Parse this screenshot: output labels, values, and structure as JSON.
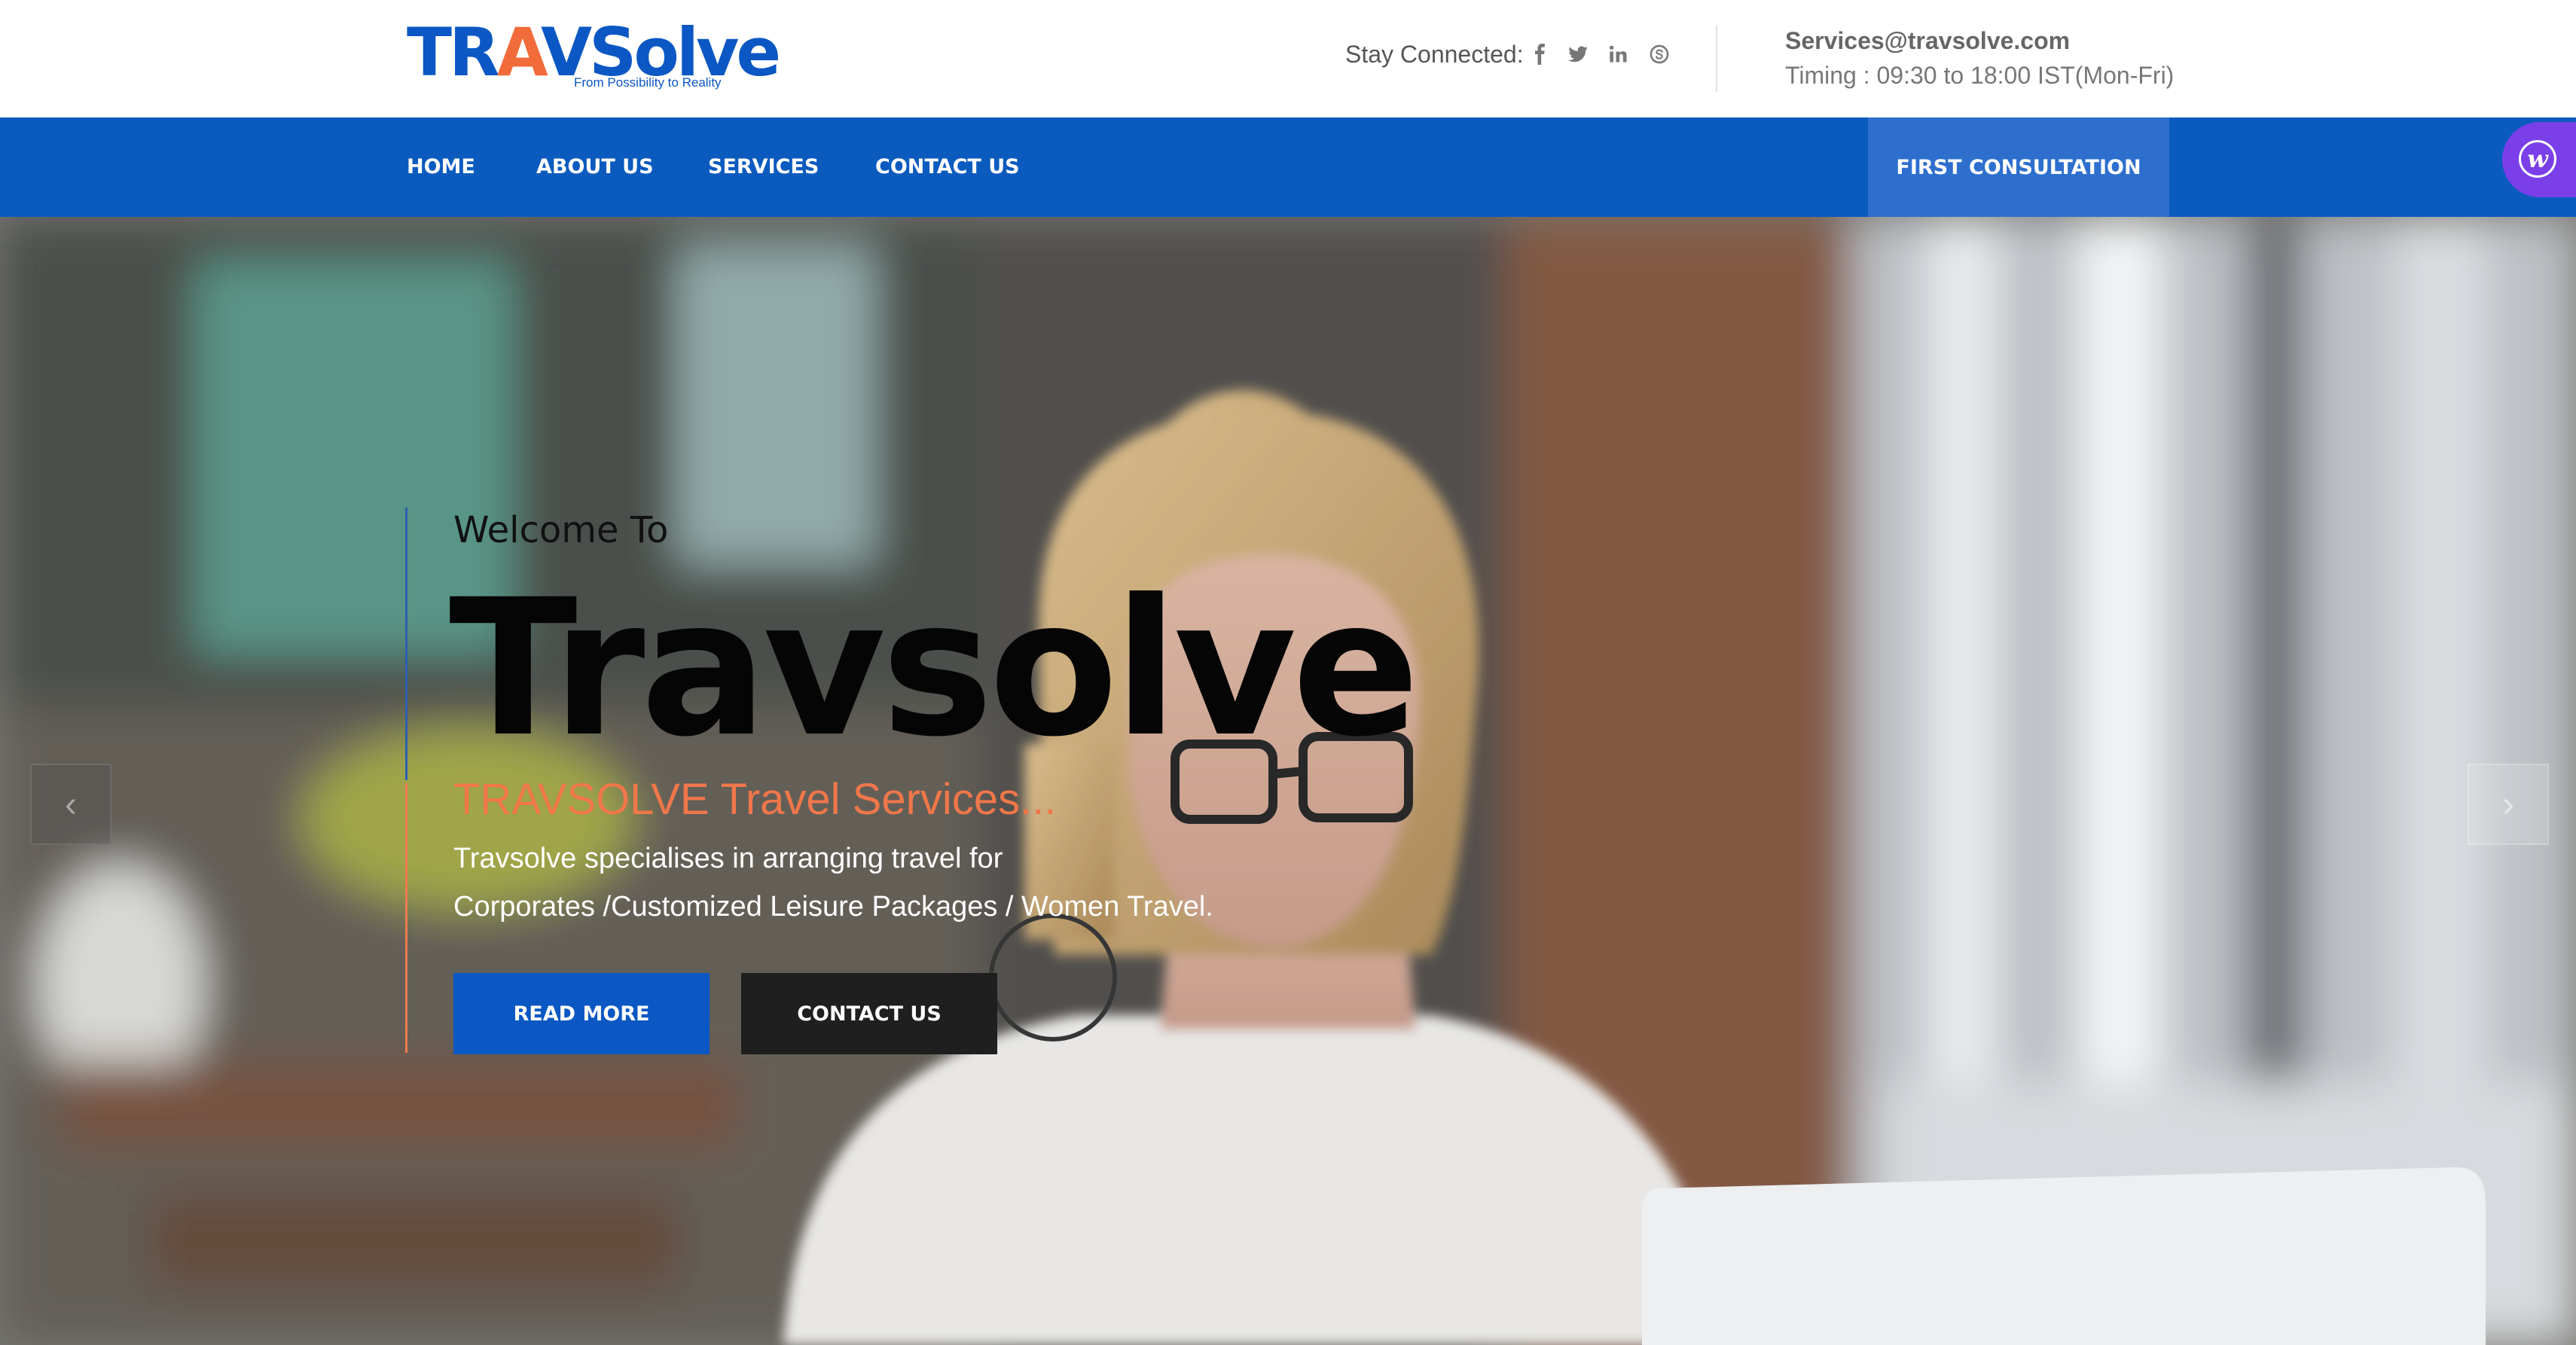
{
  "brand": {
    "logo_part1": "TR",
    "logo_part2": "A",
    "logo_part3": "VSolve",
    "tagline": "From Possibility to Reality",
    "primary_color": "#0b57c4",
    "accent_color": "#f26b3a"
  },
  "header": {
    "stay_connected_label": "Stay Connected:",
    "social_icons": [
      "facebook-icon",
      "twitter-icon",
      "linkedin-icon",
      "skype-icon"
    ],
    "email": "Services@travsolve.com",
    "timing": "Timing : 09:30 to 18:00 IST(Mon-Fri)"
  },
  "nav": {
    "items": [
      {
        "label": "HOME"
      },
      {
        "label": "ABOUT US"
      },
      {
        "label": "SERVICES"
      },
      {
        "label": "CONTACT US"
      }
    ],
    "cta_label": "FIRST CONSULTATION",
    "bar_color": "#0b5bbf"
  },
  "chat_widget": {
    "icon": "chat-widget-icon",
    "glyph": "w",
    "color": "#7a3fe8"
  },
  "hero": {
    "welcome": "Welcome To",
    "title": "Travsolve",
    "subtitle": "TRAVSOLVE Travel Services...",
    "description_line1": "Travsolve specialises in arranging travel for",
    "description_line2": "Corporates /Customized Leisure Packages / Women Travel.",
    "primary_button": "READ MORE",
    "secondary_button": "CONTACT US",
    "prev_arrow": "‹",
    "next_arrow": "›",
    "subtitle_color": "#f0774a"
  }
}
